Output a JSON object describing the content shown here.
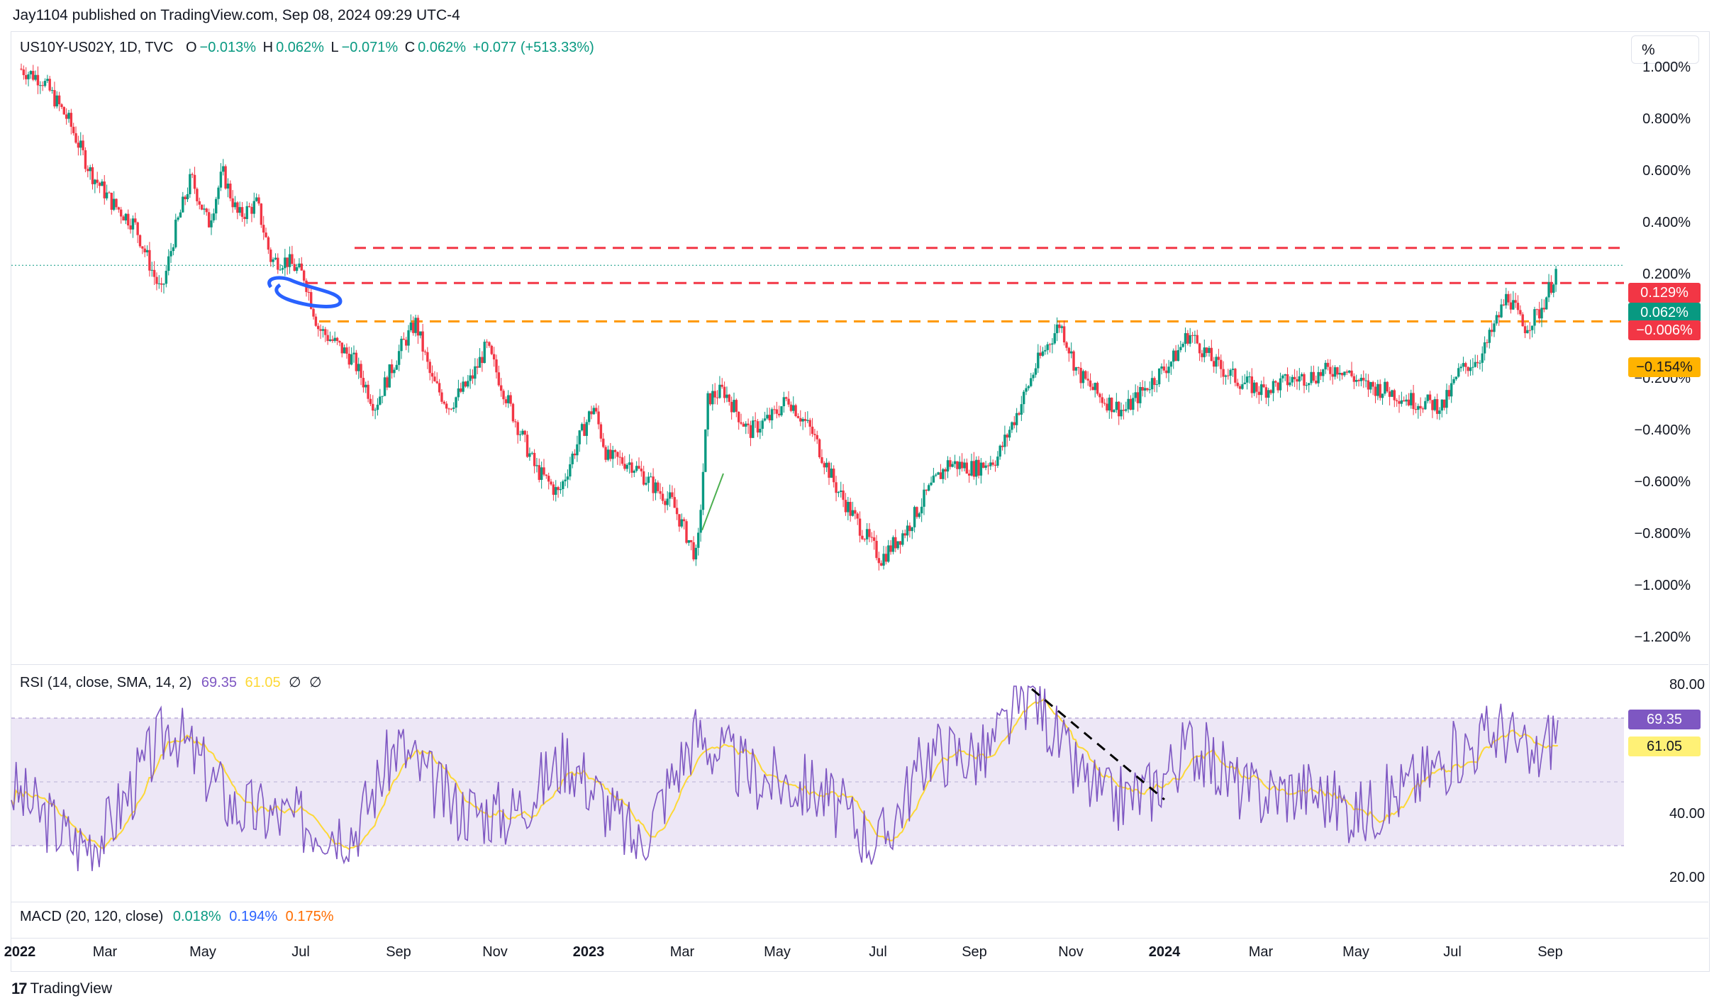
{
  "header": {
    "published": "Jay1104 published on TradingView.com, Sep 08, 2024 09:29 UTC-4"
  },
  "legend": {
    "symbol": "US10Y-US02Y, 1D, TVC",
    "o_label": "O",
    "o_value": "−0.013%",
    "h_label": "H",
    "h_value": "0.062%",
    "l_label": "L",
    "l_value": "−0.071%",
    "c_label": "C",
    "c_value": "0.062%",
    "change": "+0.077 (+513.33%)"
  },
  "scale_button": "%",
  "price_axis": [
    "1.000%",
    "0.800%",
    "0.600%",
    "0.400%",
    "0.200%",
    "−0.200%",
    "−0.400%",
    "−0.600%",
    "−0.800%",
    "−1.000%",
    "−1.200%"
  ],
  "badges": {
    "upper_level": "0.129%",
    "last_price": "0.062%",
    "middle_level": "−0.006%",
    "lower_level": "−0.154%"
  },
  "rsi": {
    "label": "RSI (14, close, SMA, 14, 2)",
    "rsi_value": "69.35",
    "sma_value": "61.05",
    "na1": "∅",
    "na2": "∅",
    "axis": [
      "80.00",
      "40.00",
      "20.00"
    ]
  },
  "macd": {
    "label": "MACD (20, 120, close)",
    "macd_value": "0.018%",
    "signal_value": "0.194%",
    "hist_value": "0.175%"
  },
  "time_axis": [
    {
      "label": "2022",
      "bold": true
    },
    {
      "label": "Mar",
      "bold": false
    },
    {
      "label": "May",
      "bold": false
    },
    {
      "label": "Jul",
      "bold": false
    },
    {
      "label": "Sep",
      "bold": false
    },
    {
      "label": "Nov",
      "bold": false
    },
    {
      "label": "2023",
      "bold": true
    },
    {
      "label": "Mar",
      "bold": false
    },
    {
      "label": "May",
      "bold": false
    },
    {
      "label": "Jul",
      "bold": false
    },
    {
      "label": "Sep",
      "bold": false
    },
    {
      "label": "Nov",
      "bold": false
    },
    {
      "label": "2024",
      "bold": true
    },
    {
      "label": "Mar",
      "bold": false
    },
    {
      "label": "May",
      "bold": false
    },
    {
      "label": "Jul",
      "bold": false
    },
    {
      "label": "Sep",
      "bold": false
    }
  ],
  "footer": {
    "brand": "TradingView"
  },
  "colors": {
    "up": "#089981",
    "down": "#f23645",
    "rsi": "#7e57c2",
    "rsi_sma": "#fdd835",
    "level_red": "#f23645",
    "level_orange": "#ff9800",
    "rsi_band": "#ede7f6",
    "marker_blue": "#2962ff",
    "macd_blue": "#2962ff",
    "hist_orange": "#ff6d00"
  },
  "chart_data": {
    "type": "candlestick",
    "title": "US10Y-US02Y, 1D, TVC",
    "ylim": [
      -1.25,
      1.05
    ],
    "y_unit": "%",
    "levels": [
      0.129,
      -0.006,
      -0.154
    ],
    "last_price": 0.062,
    "x_range": [
      "2022-01",
      "2024-10"
    ],
    "close_path": [
      {
        "x": "2022-01-01",
        "y": 0.82
      },
      {
        "x": "2022-01-15",
        "y": 0.78
      },
      {
        "x": "2022-02-01",
        "y": 0.62
      },
      {
        "x": "2022-02-15",
        "y": 0.42
      },
      {
        "x": "2022-03-01",
        "y": 0.3
      },
      {
        "x": "2022-03-15",
        "y": 0.22
      },
      {
        "x": "2022-04-01",
        "y": -0.05
      },
      {
        "x": "2022-04-10",
        "y": 0.2
      },
      {
        "x": "2022-04-20",
        "y": 0.4
      },
      {
        "x": "2022-05-01",
        "y": 0.22
      },
      {
        "x": "2022-05-10",
        "y": 0.42
      },
      {
        "x": "2022-05-20",
        "y": 0.25
      },
      {
        "x": "2022-06-01",
        "y": 0.3
      },
      {
        "x": "2022-06-10",
        "y": 0.08
      },
      {
        "x": "2022-06-20",
        "y": 0.08
      },
      {
        "x": "2022-07-01",
        "y": 0.02
      },
      {
        "x": "2022-07-10",
        "y": -0.18
      },
      {
        "x": "2022-08-01",
        "y": -0.3
      },
      {
        "x": "2022-08-15",
        "y": -0.48
      },
      {
        "x": "2022-09-01",
        "y": -0.25
      },
      {
        "x": "2022-09-10",
        "y": -0.16
      },
      {
        "x": "2022-09-20",
        "y": -0.38
      },
      {
        "x": "2022-10-01",
        "y": -0.48
      },
      {
        "x": "2022-10-15",
        "y": -0.38
      },
      {
        "x": "2022-10-25",
        "y": -0.25
      },
      {
        "x": "2022-11-10",
        "y": -0.5
      },
      {
        "x": "2022-11-25",
        "y": -0.72
      },
      {
        "x": "2022-12-10",
        "y": -0.82
      },
      {
        "x": "2022-12-20",
        "y": -0.65
      },
      {
        "x": "2023-01-01",
        "y": -0.48
      },
      {
        "x": "2023-01-10",
        "y": -0.68
      },
      {
        "x": "2023-01-25",
        "y": -0.7
      },
      {
        "x": "2023-02-10",
        "y": -0.8
      },
      {
        "x": "2023-02-20",
        "y": -0.85
      },
      {
        "x": "2023-03-08",
        "y": -1.07
      },
      {
        "x": "2023-03-15",
        "y": -0.45
      },
      {
        "x": "2023-03-25",
        "y": -0.42
      },
      {
        "x": "2023-04-10",
        "y": -0.58
      },
      {
        "x": "2023-04-25",
        "y": -0.52
      },
      {
        "x": "2023-05-05",
        "y": -0.45
      },
      {
        "x": "2023-05-20",
        "y": -0.58
      },
      {
        "x": "2023-06-05",
        "y": -0.8
      },
      {
        "x": "2023-06-20",
        "y": -0.95
      },
      {
        "x": "2023-07-03",
        "y": -1.07
      },
      {
        "x": "2023-07-20",
        "y": -0.95
      },
      {
        "x": "2023-08-01",
        "y": -0.82
      },
      {
        "x": "2023-08-15",
        "y": -0.7
      },
      {
        "x": "2023-09-01",
        "y": -0.72
      },
      {
        "x": "2023-09-15",
        "y": -0.68
      },
      {
        "x": "2023-10-01",
        "y": -0.46
      },
      {
        "x": "2023-10-10",
        "y": -0.32
      },
      {
        "x": "2023-10-25",
        "y": -0.16
      },
      {
        "x": "2023-11-05",
        "y": -0.35
      },
      {
        "x": "2023-11-20",
        "y": -0.45
      },
      {
        "x": "2023-12-05",
        "y": -0.5
      },
      {
        "x": "2023-12-20",
        "y": -0.4
      },
      {
        "x": "2024-01-05",
        "y": -0.3
      },
      {
        "x": "2024-01-15",
        "y": -0.2
      },
      {
        "x": "2024-02-01",
        "y": -0.32
      },
      {
        "x": "2024-02-15",
        "y": -0.38
      },
      {
        "x": "2024-03-01",
        "y": -0.42
      },
      {
        "x": "2024-03-20",
        "y": -0.38
      },
      {
        "x": "2024-04-05",
        "y": -0.36
      },
      {
        "x": "2024-04-20",
        "y": -0.33
      },
      {
        "x": "2024-05-05",
        "y": -0.4
      },
      {
        "x": "2024-05-20",
        "y": -0.42
      },
      {
        "x": "2024-06-05",
        "y": -0.46
      },
      {
        "x": "2024-06-25",
        "y": -0.48
      },
      {
        "x": "2024-07-05",
        "y": -0.35
      },
      {
        "x": "2024-07-20",
        "y": -0.28
      },
      {
        "x": "2024-08-05",
        "y": -0.05
      },
      {
        "x": "2024-08-15",
        "y": -0.18
      },
      {
        "x": "2024-08-25",
        "y": -0.12
      },
      {
        "x": "2024-09-01",
        "y": -0.02
      },
      {
        "x": "2024-09-06",
        "y": 0.062
      }
    ]
  }
}
